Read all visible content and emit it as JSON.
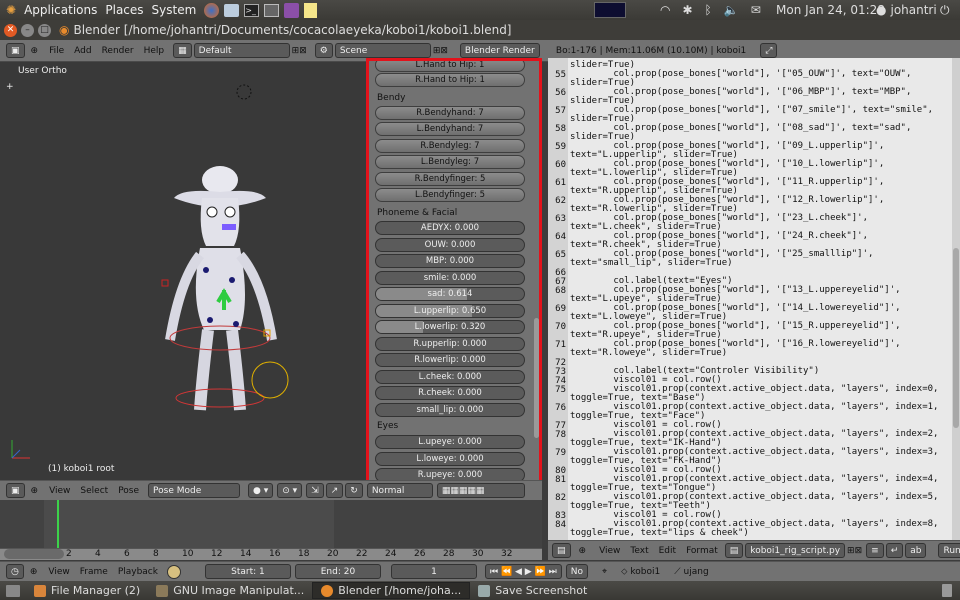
{
  "top_panel": {
    "menus": [
      "Applications",
      "Places",
      "System"
    ],
    "clock": "Mon Jan 24, 01:28",
    "user": "johantri"
  },
  "window": {
    "title": "Blender [/home/johantri/Documents/cocacolaeyeka/koboi1/koboi1.blend]"
  },
  "blender_header": {
    "menus": [
      "File",
      "Add",
      "Render",
      "Help"
    ],
    "layout": "Default",
    "scene": "Scene",
    "engine": "Blender Render",
    "stats": "Bo:1-176 | Mem:11.06M (10.10M) | koboi1"
  },
  "viewport": {
    "view_label": "User Ortho",
    "object_label": "(1) koboi1 root",
    "menus": [
      "View",
      "Select",
      "Pose"
    ],
    "mode": "Pose Mode",
    "shading": "Normal"
  },
  "properties": {
    "top_buttons": [
      "L.Hand to Hip: 1",
      "R.Hand to Hip: 1"
    ],
    "bendy_label": "Bendy",
    "bendy_buttons": [
      "R.Bendyhand: 7",
      "L.Bendyhand: 7",
      "R.Bendyleg: 7",
      "L.Bendyleg: 7",
      "R.Bendyfinger: 5",
      "L.Bendyfinger: 5"
    ],
    "phoneme_label": "Phoneme & Facial",
    "phoneme_sliders": [
      {
        "label": "AEDYX: 0.000",
        "value": 0.0
      },
      {
        "label": "OUW: 0.000",
        "value": 0.0
      },
      {
        "label": "MBP: 0.000",
        "value": 0.0
      },
      {
        "label": "smile: 0.000",
        "value": 0.0
      },
      {
        "label": "sad: 0.614",
        "value": 0.614
      },
      {
        "label": "L.upperlip: 0.650",
        "value": 0.65
      },
      {
        "label": "L.lowerlip: 0.320",
        "value": 0.32
      },
      {
        "label": "R.upperlip: 0.000",
        "value": 0.0
      },
      {
        "label": "R.lowerlip: 0.000",
        "value": 0.0
      },
      {
        "label": "L.cheek: 0.000",
        "value": 0.0
      },
      {
        "label": "R.cheek: 0.000",
        "value": 0.0
      },
      {
        "label": "small_lip: 0.000",
        "value": 0.0
      }
    ],
    "eyes_label": "Eyes",
    "eyes_sliders": [
      {
        "label": "L.upeye: 0.000",
        "value": 0.0
      },
      {
        "label": "L.loweye: 0.000",
        "value": 0.0
      },
      {
        "label": "R.upeye: 0.000",
        "value": 0.0
      }
    ]
  },
  "editor": {
    "lines": [
      {
        "n": "",
        "t": "slider=True)"
      },
      {
        "n": "55",
        "t": "        col.prop(pose_bones[\"world\"], '[\"05_OUW\"]', text=\"OUW\","
      },
      {
        "n": "",
        "t": "slider=True)"
      },
      {
        "n": "56",
        "t": "        col.prop(pose_bones[\"world\"], '[\"06_MBP\"]', text=\"MBP\","
      },
      {
        "n": "",
        "t": "slider=True)"
      },
      {
        "n": "57",
        "t": "        col.prop(pose_bones[\"world\"], '[\"07_smile\"]', text=\"smile\","
      },
      {
        "n": "",
        "t": "slider=True)"
      },
      {
        "n": "58",
        "t": "        col.prop(pose_bones[\"world\"], '[\"08_sad\"]', text=\"sad\","
      },
      {
        "n": "",
        "t": "slider=True)"
      },
      {
        "n": "59",
        "t": "        col.prop(pose_bones[\"world\"], '[\"09_L.upperlip\"]',"
      },
      {
        "n": "",
        "t": "text=\"L.upperlip\", slider=True)"
      },
      {
        "n": "60",
        "t": "        col.prop(pose_bones[\"world\"], '[\"10_L.lowerlip\"]',"
      },
      {
        "n": "",
        "t": "text=\"L.lowerlip\", slider=True)"
      },
      {
        "n": "61",
        "t": "        col.prop(pose_bones[\"world\"], '[\"11_R.upperlip\"]',"
      },
      {
        "n": "",
        "t": "text=\"R.upperlip\", slider=True)"
      },
      {
        "n": "62",
        "t": "        col.prop(pose_bones[\"world\"], '[\"12_R.lowerlip\"]',"
      },
      {
        "n": "",
        "t": "text=\"R.lowerlip\", slider=True)"
      },
      {
        "n": "63",
        "t": "        col.prop(pose_bones[\"world\"], '[\"23_L.cheek\"]',"
      },
      {
        "n": "",
        "t": "text=\"L.cheek\", slider=True)"
      },
      {
        "n": "64",
        "t": "        col.prop(pose_bones[\"world\"], '[\"24_R.cheek\"]',"
      },
      {
        "n": "",
        "t": "text=\"R.cheek\", slider=True)"
      },
      {
        "n": "65",
        "t": "        col.prop(pose_bones[\"world\"], '[\"25_smalllip\"]',"
      },
      {
        "n": "",
        "t": "text=\"small_lip\", slider=True)"
      },
      {
        "n": "66",
        "t": ""
      },
      {
        "n": "67",
        "t": "        col.label(text=\"Eyes\")"
      },
      {
        "n": "68",
        "t": "        col.prop(pose_bones[\"world\"], '[\"13_L.uppereyelid\"]',"
      },
      {
        "n": "",
        "t": "text=\"L.upeye\", slider=True)"
      },
      {
        "n": "69",
        "t": "        col.prop(pose_bones[\"world\"], '[\"14_L.lowereyelid\"]',"
      },
      {
        "n": "",
        "t": "text=\"L.loweye\", slider=True)"
      },
      {
        "n": "70",
        "t": "        col.prop(pose_bones[\"world\"], '[\"15_R.uppereyelid\"]',"
      },
      {
        "n": "",
        "t": "text=\"R.upeye\", slider=True)"
      },
      {
        "n": "71",
        "t": "        col.prop(pose_bones[\"world\"], '[\"16_R.lowereyelid\"]',"
      },
      {
        "n": "",
        "t": "text=\"R.loweye\", slider=True)"
      },
      {
        "n": "72",
        "t": ""
      },
      {
        "n": "73",
        "t": "        col.label(text=\"Controler Visibility\")"
      },
      {
        "n": "74",
        "t": "        viscol01 = col.row()"
      },
      {
        "n": "75",
        "t": "        viscol01.prop(context.active_object.data, \"layers\", index=0,"
      },
      {
        "n": "",
        "t": "toggle=True, text=\"Base\")"
      },
      {
        "n": "76",
        "t": "        viscol01.prop(context.active_object.data, \"layers\", index=1,"
      },
      {
        "n": "",
        "t": "toggle=True, text=\"Face\")"
      },
      {
        "n": "77",
        "t": "        viscol01 = col.row()"
      },
      {
        "n": "78",
        "t": "        viscol01.prop(context.active_object.data, \"layers\", index=2,"
      },
      {
        "n": "",
        "t": "toggle=True, text=\"IK-Hand\")"
      },
      {
        "n": "79",
        "t": "        viscol01.prop(context.active_object.data, \"layers\", index=3,"
      },
      {
        "n": "",
        "t": "toggle=True, text=\"FK-Hand\")"
      },
      {
        "n": "80",
        "t": "        viscol01 = col.row()"
      },
      {
        "n": "81",
        "t": "        viscol01.prop(context.active_object.data, \"layers\", index=4,"
      },
      {
        "n": "",
        "t": "toggle=True, text=\"Tongue\")"
      },
      {
        "n": "82",
        "t": "        viscol01.prop(context.active_object.data, \"layers\", index=5,"
      },
      {
        "n": "",
        "t": "toggle=True, text=\"Teeth\")"
      },
      {
        "n": "83",
        "t": "        viscol01 = col.row()"
      },
      {
        "n": "84",
        "t": "        viscol01.prop(context.active_object.data, \"layers\", index=8,"
      },
      {
        "n": "",
        "t": "toggle=True, text=\"lips & cheek\")"
      }
    ],
    "menus": [
      "View",
      "Text",
      "Edit",
      "Format"
    ],
    "filename": "koboi1_rig_script.py",
    "run_label": "Run"
  },
  "timeline": {
    "ticks": [
      "-2",
      "0",
      "2",
      "4",
      "6",
      "8",
      "10",
      "12",
      "14",
      "16",
      "18",
      "20",
      "22",
      "24",
      "26",
      "28",
      "30",
      "32"
    ],
    "menus": [
      "View",
      "Frame",
      "Playback"
    ],
    "start": "Start: 1",
    "end": "End: 20",
    "current": "1",
    "no_sync": "No",
    "armature": "koboi1",
    "bone": "ujang"
  },
  "taskbar": {
    "items": [
      "File Manager (2)",
      "GNU Image Manipulat...",
      "Blender [/home/joha...",
      "Save Screenshot"
    ]
  },
  "colors": {
    "highlight_frame": "#e3121b",
    "close_button": "#e25a24"
  }
}
